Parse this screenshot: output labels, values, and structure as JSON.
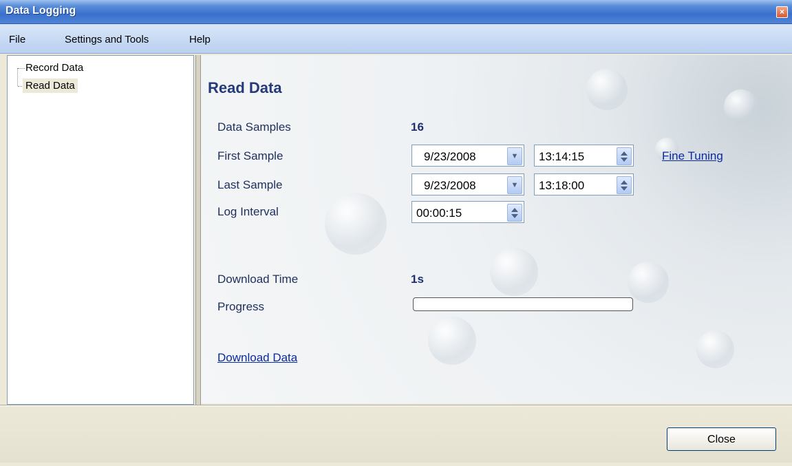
{
  "window": {
    "title": "Data Logging",
    "close_glyph": "×"
  },
  "menu": {
    "items": [
      "File",
      "Settings and Tools",
      "Help"
    ]
  },
  "tree": {
    "items": [
      {
        "label": "Record Data"
      },
      {
        "label": "Read Data",
        "selected": true
      }
    ]
  },
  "content": {
    "title": "Read Data",
    "data_samples": {
      "label": "Data Samples",
      "value": "16"
    },
    "first_sample": {
      "label": "First Sample",
      "date": "9/23/2008",
      "time": "13:14:15"
    },
    "last_sample": {
      "label": "Last Sample",
      "date": "9/23/2008",
      "time": "13:18:00"
    },
    "log_interval": {
      "label": "Log Interval",
      "value": "00:00:15"
    },
    "fine_tuning": "Fine Tuning",
    "download_time": {
      "label": "Download Time",
      "value": "1s"
    },
    "progress": {
      "label": "Progress",
      "value": 0
    },
    "download_link": "Download Data"
  },
  "footer": {
    "close_label": "Close"
  },
  "icons": {
    "dropdown": "chevron-down-icon",
    "spinner": "spin-up-down-icon",
    "close": "close-icon"
  },
  "colors": {
    "title_bar": "#3a70cc",
    "label_text": "#20305e",
    "value_text": "#1f2f74",
    "link": "#0b2aa3"
  }
}
